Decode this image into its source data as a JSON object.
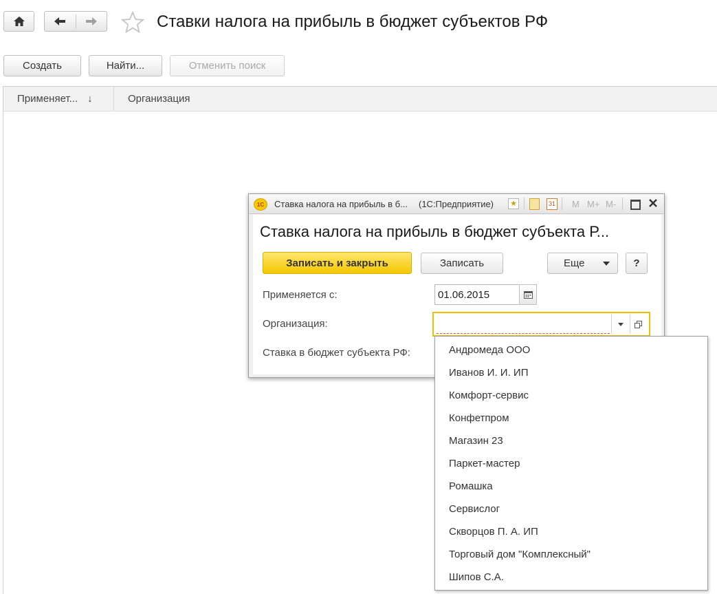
{
  "page": {
    "title": "Ставки налога на прибыль в бюджет субъектов РФ"
  },
  "toolbar": {
    "create_label": "Создать",
    "find_label": "Найти...",
    "cancel_search_label": "Отменить поиск"
  },
  "list": {
    "columns": [
      {
        "label": "Применяет...",
        "sort": "↓"
      },
      {
        "label": "Организация"
      }
    ]
  },
  "dialog": {
    "window_title": "Ставка налога на прибыль в б...",
    "app_name": "(1С:Предприятие)",
    "heading": "Ставка налога на прибыль в бюджет субъекта Р...",
    "write_close_label": "Записать и закрыть",
    "write_label": "Записать",
    "more_label": "Еще",
    "help_label": "?",
    "titlebar_memory": [
      "M",
      "M+",
      "M-"
    ],
    "calendar_day": "31",
    "fields": {
      "applies_label": "Применяется с:",
      "applies_value": "01.06.2015",
      "org_label": "Организация:",
      "org_value": "",
      "rate_label": "Ставка в бюджет субъекта РФ:"
    }
  },
  "dropdown": {
    "items": [
      "Андромеда ООО",
      "Иванов И. И. ИП",
      "Комфорт-сервис",
      "Конфетпром",
      "Магазин 23",
      "Паркет-мастер",
      "Ромашка",
      "Сервислог",
      "Скворцов П. А. ИП",
      "Торговый дом \"Комплексный\"",
      "Шипов С.А."
    ]
  },
  "colors": {
    "primary_button": "#f5c800",
    "focus_border": "#f0c000",
    "logo": "#e8412c"
  }
}
